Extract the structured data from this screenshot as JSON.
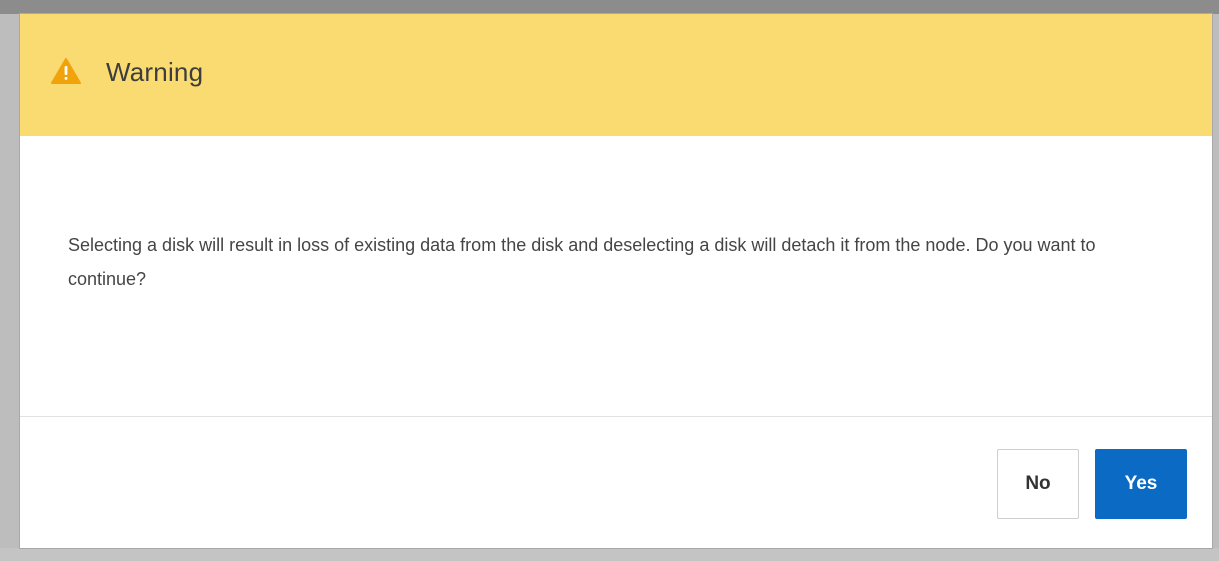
{
  "dialog": {
    "icon": "warning-triangle-icon",
    "title": "Warning",
    "message": "Selecting a disk will result in loss of existing data from the disk and deselecting a disk will detach it from the node. Do you want to continue?",
    "buttons": {
      "no_label": "No",
      "yes_label": "Yes"
    }
  },
  "colors": {
    "header_background": "#fadb72",
    "warning_icon": "#f0a30a",
    "primary_button": "#0a6ac4"
  }
}
